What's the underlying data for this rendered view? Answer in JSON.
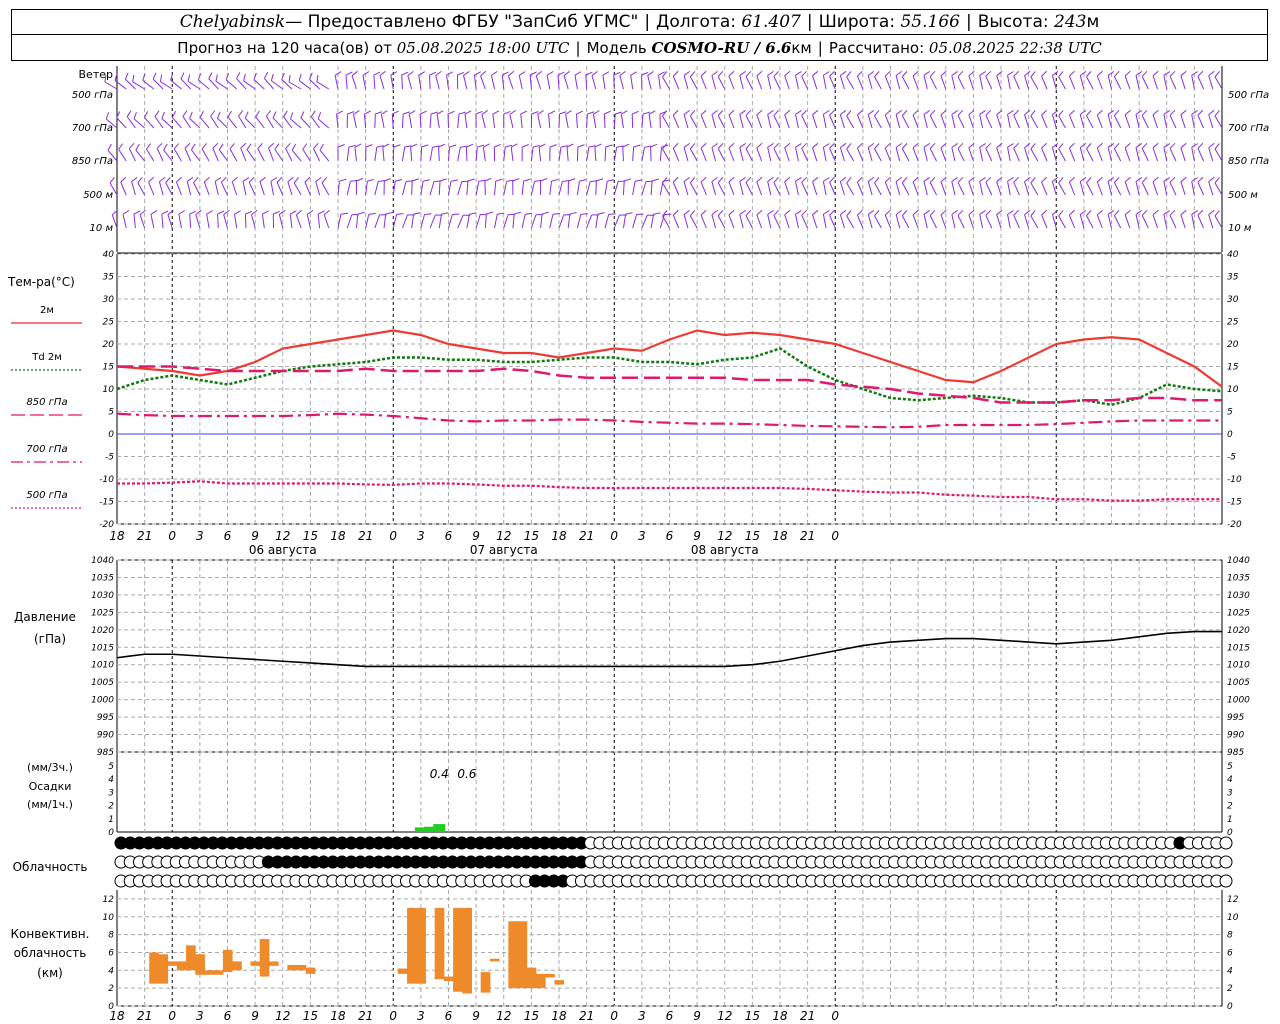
{
  "header": {
    "city": "Chelyabinsk",
    "provided": " — Предоставлено ФГБУ \"ЗапСиб УГМС\"",
    "lon_label": "Долгота:",
    "lon": "61.407",
    "lat_label": "Широта:",
    "lat": "55.166",
    "alt_label": "Высота:",
    "alt": "243",
    "alt_unit": "м",
    "forecast_label": "Прогноз на 120 часа(ов) от",
    "forecast_time": "05.08.2025 18:00 UTC",
    "model_label": "Модель",
    "model": "COSMO-RU / 6.6",
    "model_unit": "км",
    "calc_label": "Рассчитано:",
    "calc_time": "05.08.2025 22:38 UTC"
  },
  "time_axis": {
    "hour_labels": [
      "18",
      "21",
      "0",
      "3",
      "6",
      "9",
      "12",
      "15",
      "18",
      "21",
      "0",
      "3",
      "6",
      "9",
      "12",
      "15",
      "18",
      "21",
      "0",
      "3",
      "6",
      "9",
      "12",
      "15",
      "18",
      "21",
      "0"
    ],
    "day_labels": [
      "06 августа",
      "07 августа",
      "08 августа"
    ],
    "day_label_hours": [
      18,
      42,
      66
    ]
  },
  "wind_panel": {
    "title": "Ветер",
    "levels": [
      "500 гПа",
      "700 гПа",
      "850 гПа",
      "500 м",
      "10  м"
    ],
    "barb_color": "#8a2be2"
  },
  "temp_panel": {
    "title": "Тем-ра(°C)",
    "legend": [
      {
        "label": "2м",
        "color": "#ee2a2a",
        "style": "solid"
      },
      {
        "label": "Td  2м",
        "color": "#0e7a0e",
        "style": "dotted"
      },
      {
        "label": "850 гПа",
        "color": "#e0186e",
        "style": "dashed"
      },
      {
        "label": "700 гПа",
        "color": "#e0186e",
        "style": "dashdot"
      },
      {
        "label": "500 гПа",
        "color": "#e0186e",
        "style": "dotted"
      }
    ],
    "y_ticks": [
      40,
      35,
      30,
      25,
      20,
      15,
      10,
      5,
      0,
      -5,
      -10,
      -15,
      -20
    ]
  },
  "pressure_panel": {
    "title": "Давление",
    "unit": "(гПа)",
    "y_ticks": [
      1040,
      1035,
      1030,
      1025,
      1020,
      1015,
      1010,
      1005,
      1000,
      995,
      990,
      985
    ]
  },
  "precip_panel": {
    "unit3": "(мм/3ч.)",
    "title": "Осадки",
    "unit1": "(мм/1ч.)",
    "y_ticks": [
      5,
      4,
      3,
      2,
      1,
      0
    ],
    "annotations": [
      "0.4",
      "0.6"
    ],
    "annotation_hours": [
      35,
      38
    ]
  },
  "cloud_panel": {
    "title": "Облачность"
  },
  "conv_panel": {
    "title_line1": "Конвективн.",
    "title_line2": "облачность",
    "unit": "(км)",
    "y_ticks": [
      12,
      10,
      8,
      6,
      4,
      2,
      0
    ]
  },
  "chart_data": [
    {
      "type": "line",
      "title": "Тем-ра(°C)",
      "ylim": [
        -20,
        40
      ],
      "x_hours": [
        0,
        3,
        6,
        9,
        12,
        15,
        18,
        21,
        24,
        27,
        30,
        33,
        36,
        39,
        42,
        45,
        48,
        51,
        54,
        57,
        60,
        63,
        66,
        69,
        72,
        75,
        78,
        81,
        84,
        87,
        90,
        93,
        96,
        99,
        102,
        105,
        108,
        111,
        114,
        117,
        120
      ],
      "series": [
        {
          "name": "2м",
          "values": [
            15,
            14.5,
            14,
            13,
            14,
            16,
            19,
            20,
            21,
            22,
            23,
            22,
            20,
            19,
            18,
            18,
            17,
            18,
            19,
            18.5,
            21,
            23,
            22,
            22.5,
            22,
            21,
            20,
            18,
            16,
            14,
            12,
            11.5,
            14,
            17,
            20,
            21,
            21.5,
            21,
            18,
            15,
            10.5
          ]
        },
        {
          "name": "Td  2м",
          "values": [
            10,
            12,
            13,
            12,
            11,
            12.5,
            14,
            15,
            15.5,
            16,
            17,
            17,
            16.5,
            16.5,
            16,
            16,
            16.5,
            17,
            17,
            16,
            16,
            15.5,
            16.5,
            17,
            19,
            15,
            12,
            10,
            8,
            7.5,
            8,
            8.5,
            8,
            7,
            7,
            7.5,
            6.5,
            8,
            11,
            10,
            9.5
          ]
        },
        {
          "name": "850 гПа",
          "values": [
            15,
            15,
            15,
            14.5,
            14,
            14,
            14,
            14,
            14,
            14.5,
            14,
            14,
            14,
            14,
            14.5,
            14,
            13,
            12.5,
            12.5,
            12.5,
            12.5,
            12.5,
            12.5,
            12,
            12,
            12,
            11,
            10.5,
            10,
            9,
            8.5,
            8,
            7,
            7,
            7,
            7.5,
            7.5,
            8,
            8,
            7.5,
            7.5
          ]
        },
        {
          "name": "700 гПа",
          "values": [
            4.5,
            4.2,
            4,
            4,
            4,
            4,
            4,
            4.2,
            4.5,
            4.3,
            4,
            3.5,
            3,
            2.8,
            3,
            3,
            3.2,
            3.2,
            3,
            2.7,
            2.5,
            2.3,
            2.3,
            2.2,
            2,
            1.8,
            1.7,
            1.6,
            1.5,
            1.6,
            2,
            2,
            2,
            2,
            2.2,
            2.5,
            2.8,
            3,
            3,
            3,
            3
          ]
        },
        {
          "name": "500 гПа",
          "values": [
            -11,
            -11,
            -10.8,
            -10.5,
            -11,
            -11,
            -11,
            -11,
            -11,
            -11.2,
            -11.3,
            -11,
            -11,
            -11.2,
            -11.5,
            -11.5,
            -11.8,
            -12,
            -12,
            -12,
            -12,
            -12,
            -12,
            -12,
            -12,
            -12.2,
            -12.5,
            -12.8,
            -13,
            -13,
            -13.5,
            -13.7,
            -14,
            -14,
            -14.5,
            -14.5,
            -14.8,
            -14.8,
            -14.5,
            -14.5,
            -14.5
          ]
        }
      ]
    },
    {
      "type": "line",
      "title": "Давление",
      "ylim": [
        985,
        1040
      ],
      "x_hours": [
        0,
        3,
        6,
        9,
        12,
        15,
        18,
        21,
        24,
        27,
        30,
        33,
        36,
        39,
        42,
        45,
        48,
        51,
        54,
        57,
        60,
        63,
        66,
        69,
        72,
        75,
        78,
        81,
        84,
        87,
        90,
        93,
        96,
        99,
        102,
        105,
        108,
        111,
        114,
        117,
        120
      ],
      "series": [
        {
          "name": "Давление",
          "values": [
            1012,
            1013,
            1013,
            1012.5,
            1012,
            1011.5,
            1011,
            1010.5,
            1010,
            1009.5,
            1009.5,
            1009.5,
            1009.5,
            1009.5,
            1009.5,
            1009.5,
            1009.5,
            1009.5,
            1009.5,
            1009.5,
            1009.5,
            1009.5,
            1009.5,
            1010,
            1011,
            1012.5,
            1014,
            1015.5,
            1016.5,
            1017,
            1017.5,
            1017.5,
            1017,
            1016.5,
            1016,
            1016.5,
            1017,
            1018,
            1019,
            1019.5,
            1019.5
          ]
        }
      ]
    },
    {
      "type": "bar",
      "title": "Осадки",
      "ylim": [
        0,
        5
      ],
      "x_hours": [
        33,
        34,
        35
      ],
      "values": [
        0.35,
        0.4,
        0.6
      ]
    },
    {
      "type": "bar",
      "title": "Конвективн. облачность",
      "ylim": [
        0,
        13
      ],
      "bars": [
        {
          "hour": 4,
          "top": 6,
          "base": 2.5
        },
        {
          "hour": 5,
          "top": 5.8,
          "base": 2.5
        },
        {
          "hour": 6,
          "top": 5,
          "base": 4.5
        },
        {
          "hour": 7,
          "top": 5,
          "base": 4
        },
        {
          "hour": 8,
          "top": 6.8,
          "base": 4
        },
        {
          "hour": 9,
          "top": 5.8,
          "base": 3.5
        },
        {
          "hour": 10,
          "top": 4,
          "base": 3.5
        },
        {
          "hour": 11,
          "top": 4,
          "base": 3.5
        },
        {
          "hour": 12,
          "top": 6.3,
          "base": 3.8
        },
        {
          "hour": 13,
          "top": 5,
          "base": 4
        },
        {
          "hour": 15,
          "top": 5,
          "base": 4.5
        },
        {
          "hour": 16,
          "top": 7.5,
          "base": 3.3
        },
        {
          "hour": 17,
          "top": 5,
          "base": 4.5
        },
        {
          "hour": 19,
          "top": 4.6,
          "base": 4
        },
        {
          "hour": 20,
          "top": 4.6,
          "base": 4
        },
        {
          "hour": 21,
          "top": 4.3,
          "base": 3.6
        },
        {
          "hour": 31,
          "top": 4.2,
          "base": 3.6
        },
        {
          "hour": 32,
          "top": 11,
          "base": 2.5
        },
        {
          "hour": 33,
          "top": 11,
          "base": 2.5
        },
        {
          "hour": 35,
          "top": 11,
          "base": 3
        },
        {
          "hour": 36,
          "top": 3.3,
          "base": 2.8
        },
        {
          "hour": 37,
          "top": 11,
          "base": 1.6
        },
        {
          "hour": 38,
          "top": 11,
          "base": 1.4
        },
        {
          "hour": 40,
          "top": 3.8,
          "base": 1.5
        },
        {
          "hour": 41,
          "top": 5.3,
          "base": 5
        },
        {
          "hour": 43,
          "top": 9.5,
          "base": 2
        },
        {
          "hour": 44,
          "top": 9.5,
          "base": 2
        },
        {
          "hour": 45,
          "top": 4.3,
          "base": 2
        },
        {
          "hour": 46,
          "top": 3.6,
          "base": 2
        },
        {
          "hour": 47,
          "top": 3.6,
          "base": 3.2
        },
        {
          "hour": 48,
          "top": 2.9,
          "base": 2.4
        }
      ]
    }
  ]
}
